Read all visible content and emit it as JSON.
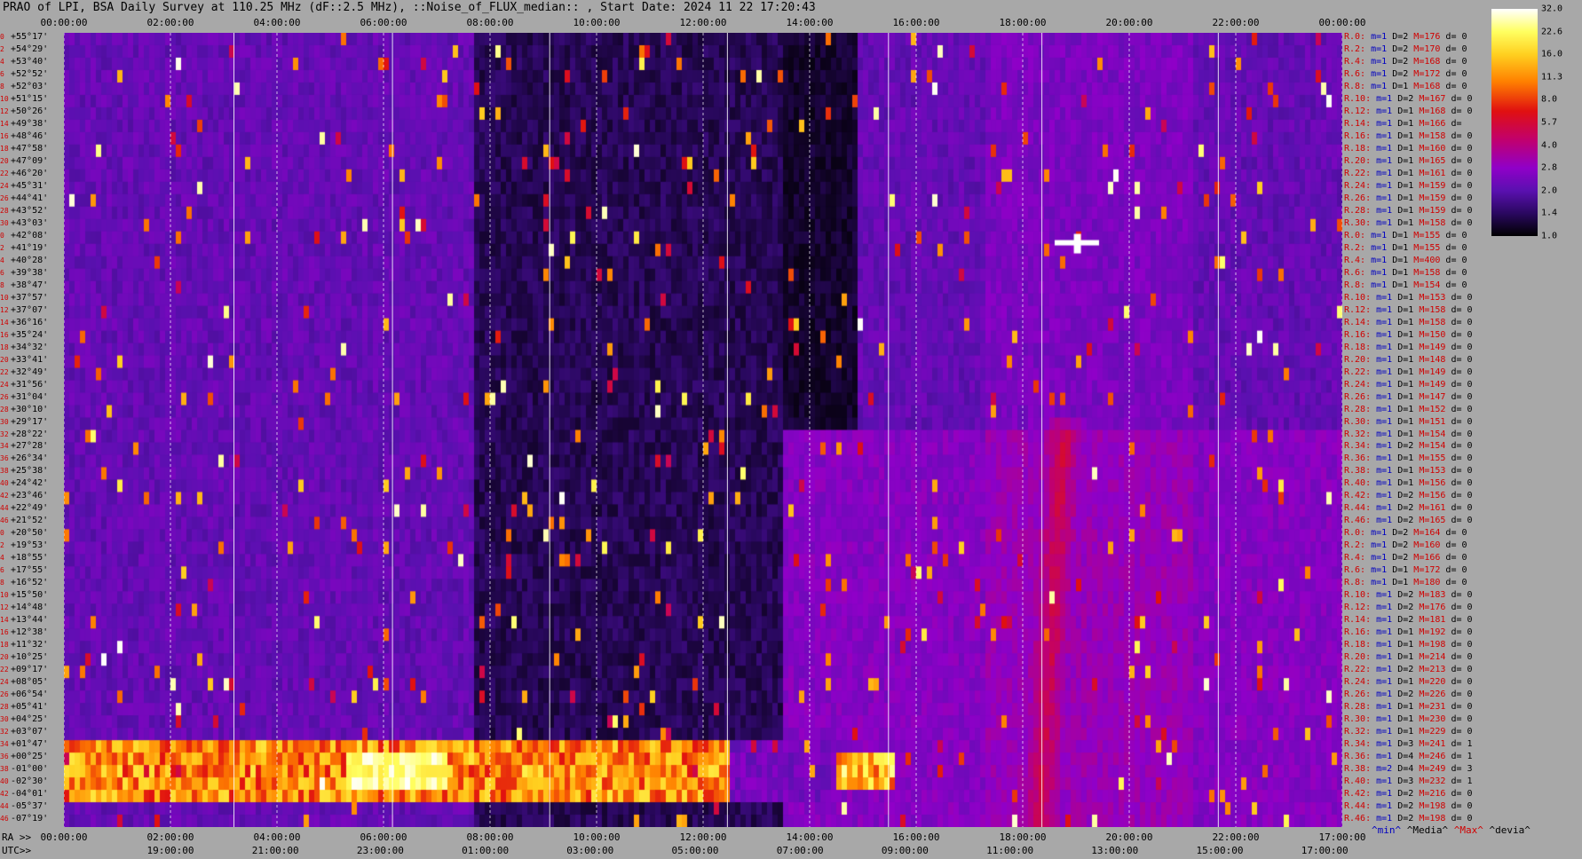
{
  "title": "PRAO of LPI, BSA Daily Survey at 110.25 MHz (dF::2.5 MHz), ::Noise_of_FLUX_median:: , Start Date: 2024 11 22 17:20:43",
  "axis": {
    "ra_prefix": "RA >>",
    "utc_prefix": "UTC>>",
    "top_ticks": [
      "00:00:00",
      "02:00:00",
      "04:00:00",
      "06:00:00",
      "08:00:00",
      "10:00:00",
      "12:00:00",
      "14:00:00",
      "16:00:00",
      "18:00:00",
      "20:00:00",
      "22:00:00",
      "00:00:00"
    ],
    "ra_ticks": [
      "00:00:00",
      "02:00:00",
      "04:00:00",
      "06:00:00",
      "08:00:00",
      "10:00:00",
      "12:00:00",
      "14:00:00",
      "16:00:00",
      "18:00:00",
      "20:00:00",
      "22:00:00",
      "17:00:00"
    ],
    "utc_ticks": [
      "19:00:00",
      "21:00:00",
      "23:00:00",
      "01:00:00",
      "03:00:00",
      "05:00:00",
      "07:00:00",
      "09:00:00",
      "11:00:00",
      "13:00:00",
      "15:00:00",
      "17:00:00"
    ]
  },
  "colors": {
    "stat_beam": "#d00000",
    "stat_min": "#0000c0",
    "stat_max": "#d00000",
    "dec_index": "#d00000",
    "background": "#a8a8a8"
  },
  "colorbar": {
    "ticks": [
      "32.0",
      "22.6",
      "16.0",
      "11.3",
      "8.0",
      "5.7",
      "4.0",
      "2.8",
      "2.0",
      "1.4",
      "1.0"
    ]
  },
  "legend": {
    "min": "^min^",
    "median": "^Media^",
    "max": "^Max^",
    "dev": "^devia^"
  },
  "chart_data": {
    "type": "heatmap",
    "x_axis_top": "RA 00:00:00 to 00:00:00",
    "value_scale": "log",
    "value_range": [
      1.0,
      32.0
    ],
    "rows": [
      {
        "idx": "0",
        "dec": "+55°17'",
        "beam": "R.0:",
        "m": "1",
        "D": "2",
        "M": "176",
        "d": "0"
      },
      {
        "idx": "2",
        "dec": "+54°29'",
        "beam": "R.2:",
        "m": "1",
        "D": "2",
        "M": "170",
        "d": "0"
      },
      {
        "idx": "4",
        "dec": "+53°40'",
        "beam": "R.4:",
        "m": "1",
        "D": "2",
        "M": "168",
        "d": "0"
      },
      {
        "idx": "6",
        "dec": "+52°52'",
        "beam": "R.6:",
        "m": "1",
        "D": "2",
        "M": "172",
        "d": "0"
      },
      {
        "idx": "8",
        "dec": "+52°03'",
        "beam": "R.8:",
        "m": "1",
        "D": "1",
        "M": "168",
        "d": "0"
      },
      {
        "idx": "10",
        "dec": "+51°15'",
        "beam": "R.10:",
        "m": "1",
        "D": "2",
        "M": "167",
        "d": "0"
      },
      {
        "idx": "12",
        "dec": "+50°26'",
        "beam": "R.12:",
        "m": "1",
        "D": "1",
        "M": "168",
        "d": "0"
      },
      {
        "idx": "14",
        "dec": "+49°38'",
        "beam": "R.14:",
        "m": "1",
        "D": "1",
        "M": "166",
        "d": ""
      },
      {
        "idx": "16",
        "dec": "+48°46'",
        "beam": "R.16:",
        "m": "1",
        "D": "1",
        "M": "158",
        "d": "0"
      },
      {
        "idx": "18",
        "dec": "+47°58'",
        "beam": "R.18:",
        "m": "1",
        "D": "1",
        "M": "160",
        "d": "0"
      },
      {
        "idx": "20",
        "dec": "+47°09'",
        "beam": "R.20:",
        "m": "1",
        "D": "1",
        "M": "165",
        "d": "0"
      },
      {
        "idx": "22",
        "dec": "+46°20'",
        "beam": "R.22:",
        "m": "1",
        "D": "1",
        "M": "161",
        "d": "0"
      },
      {
        "idx": "24",
        "dec": "+45°31'",
        "beam": "R.24:",
        "m": "1",
        "D": "1",
        "M": "159",
        "d": "0"
      },
      {
        "idx": "26",
        "dec": "+44°41'",
        "beam": "R.26:",
        "m": "1",
        "D": "1",
        "M": "159",
        "d": "0"
      },
      {
        "idx": "28",
        "dec": "+43°52'",
        "beam": "R.28:",
        "m": "1",
        "D": "1",
        "M": "159",
        "d": "0"
      },
      {
        "idx": "30",
        "dec": "+43°03'",
        "beam": "R.30:",
        "m": "1",
        "D": "1",
        "M": "158",
        "d": "0"
      },
      {
        "idx": "0",
        "dec": "+42°08'",
        "beam": "R.0:",
        "m": "1",
        "D": "1",
        "M": "155",
        "d": "0"
      },
      {
        "idx": "2",
        "dec": "+41°19'",
        "beam": "R.2:",
        "m": "1",
        "D": "1",
        "M": "155",
        "d": "0"
      },
      {
        "idx": "4",
        "dec": "+40°28'",
        "beam": "R.4:",
        "m": "1",
        "D": "1",
        "M": "400",
        "d": "0"
      },
      {
        "idx": "6",
        "dec": "+39°38'",
        "beam": "R.6:",
        "m": "1",
        "D": "1",
        "M": "158",
        "d": "0"
      },
      {
        "idx": "8",
        "dec": "+38°47'",
        "beam": "R.8:",
        "m": "1",
        "D": "1",
        "M": "154",
        "d": "0"
      },
      {
        "idx": "10",
        "dec": "+37°57'",
        "beam": "R.10:",
        "m": "1",
        "D": "1",
        "M": "153",
        "d": "0"
      },
      {
        "idx": "12",
        "dec": "+37°07'",
        "beam": "R.12:",
        "m": "1",
        "D": "1",
        "M": "158",
        "d": "0"
      },
      {
        "idx": "14",
        "dec": "+36°16'",
        "beam": "R.14:",
        "m": "1",
        "D": "1",
        "M": "158",
        "d": "0"
      },
      {
        "idx": "16",
        "dec": "+35°24'",
        "beam": "R.16:",
        "m": "1",
        "D": "1",
        "M": "150",
        "d": "0"
      },
      {
        "idx": "18",
        "dec": "+34°32'",
        "beam": "R.18:",
        "m": "1",
        "D": "1",
        "M": "149",
        "d": "0"
      },
      {
        "idx": "20",
        "dec": "+33°41'",
        "beam": "R.20:",
        "m": "1",
        "D": "1",
        "M": "148",
        "d": "0"
      },
      {
        "idx": "22",
        "dec": "+32°49'",
        "beam": "R.22:",
        "m": "1",
        "D": "1",
        "M": "149",
        "d": "0"
      },
      {
        "idx": "24",
        "dec": "+31°56'",
        "beam": "R.24:",
        "m": "1",
        "D": "1",
        "M": "149",
        "d": "0"
      },
      {
        "idx": "26",
        "dec": "+31°04'",
        "beam": "R.26:",
        "m": "1",
        "D": "1",
        "M": "147",
        "d": "0"
      },
      {
        "idx": "28",
        "dec": "+30°10'",
        "beam": "R.28:",
        "m": "1",
        "D": "1",
        "M": "152",
        "d": "0"
      },
      {
        "idx": "30",
        "dec": "+29°17'",
        "beam": "R.30:",
        "m": "1",
        "D": "1",
        "M": "151",
        "d": "0"
      },
      {
        "idx": "32",
        "dec": "+28°22'",
        "beam": "R.32:",
        "m": "1",
        "D": "1",
        "M": "154",
        "d": "0"
      },
      {
        "idx": "34",
        "dec": "+27°28'",
        "beam": "R.34:",
        "m": "1",
        "D": "2",
        "M": "154",
        "d": "0"
      },
      {
        "idx": "36",
        "dec": "+26°34'",
        "beam": "R.36:",
        "m": "1",
        "D": "1",
        "M": "155",
        "d": "0"
      },
      {
        "idx": "38",
        "dec": "+25°38'",
        "beam": "R.38:",
        "m": "1",
        "D": "1",
        "M": "153",
        "d": "0"
      },
      {
        "idx": "40",
        "dec": "+24°42'",
        "beam": "R.40:",
        "m": "1",
        "D": "1",
        "M": "156",
        "d": "0"
      },
      {
        "idx": "42",
        "dec": "+23°46'",
        "beam": "R.42:",
        "m": "1",
        "D": "2",
        "M": "156",
        "d": "0"
      },
      {
        "idx": "44",
        "dec": "+22°49'",
        "beam": "R.44:",
        "m": "1",
        "D": "2",
        "M": "161",
        "d": "0"
      },
      {
        "idx": "46",
        "dec": "+21°52'",
        "beam": "R.46:",
        "m": "1",
        "D": "2",
        "M": "165",
        "d": "0"
      },
      {
        "idx": "0",
        "dec": "+20°50'",
        "beam": "R.0:",
        "m": "1",
        "D": "2",
        "M": "164",
        "d": "0"
      },
      {
        "idx": "2",
        "dec": "+19°53'",
        "beam": "R.2:",
        "m": "1",
        "D": "2",
        "M": "160",
        "d": "0"
      },
      {
        "idx": "4",
        "dec": "+18°55'",
        "beam": "R.4:",
        "m": "1",
        "D": "2",
        "M": "166",
        "d": "0"
      },
      {
        "idx": "6",
        "dec": "+17°55'",
        "beam": "R.6:",
        "m": "1",
        "D": "1",
        "M": "172",
        "d": "0"
      },
      {
        "idx": "8",
        "dec": "+16°52'",
        "beam": "R.8:",
        "m": "1",
        "D": "1",
        "M": "180",
        "d": "0"
      },
      {
        "idx": "10",
        "dec": "+15°50'",
        "beam": "R.10:",
        "m": "1",
        "D": "2",
        "M": "183",
        "d": "0"
      },
      {
        "idx": "12",
        "dec": "+14°48'",
        "beam": "R.12:",
        "m": "1",
        "D": "2",
        "M": "176",
        "d": "0"
      },
      {
        "idx": "14",
        "dec": "+13°44'",
        "beam": "R.14:",
        "m": "1",
        "D": "2",
        "M": "181",
        "d": "0"
      },
      {
        "idx": "16",
        "dec": "+12°38'",
        "beam": "R.16:",
        "m": "1",
        "D": "1",
        "M": "192",
        "d": "0"
      },
      {
        "idx": "18",
        "dec": "+11°32'",
        "beam": "R.18:",
        "m": "1",
        "D": "1",
        "M": "198",
        "d": "0"
      },
      {
        "idx": "20",
        "dec": "+10°25'",
        "beam": "R.20:",
        "m": "1",
        "D": "1",
        "M": "214",
        "d": "0"
      },
      {
        "idx": "22",
        "dec": "+09°17'",
        "beam": "R.22:",
        "m": "1",
        "D": "2",
        "M": "213",
        "d": "0"
      },
      {
        "idx": "24",
        "dec": "+08°05'",
        "beam": "R.24:",
        "m": "1",
        "D": "1",
        "M": "220",
        "d": "0"
      },
      {
        "idx": "26",
        "dec": "+06°54'",
        "beam": "R.26:",
        "m": "1",
        "D": "2",
        "M": "226",
        "d": "0"
      },
      {
        "idx": "28",
        "dec": "+05°41'",
        "beam": "R.28:",
        "m": "1",
        "D": "1",
        "M": "231",
        "d": "0"
      },
      {
        "idx": "30",
        "dec": "+04°25'",
        "beam": "R.30:",
        "m": "1",
        "D": "1",
        "M": "230",
        "d": "0"
      },
      {
        "idx": "32",
        "dec": "+03°07'",
        "beam": "R.32:",
        "m": "1",
        "D": "1",
        "M": "229",
        "d": "0"
      },
      {
        "idx": "34",
        "dec": "+01°47'",
        "beam": "R.34:",
        "m": "1",
        "D": "3",
        "M": "241",
        "d": "1"
      },
      {
        "idx": "36",
        "dec": "+00°25'",
        "beam": "R.36:",
        "m": "1",
        "D": "4",
        "M": "246",
        "d": "1"
      },
      {
        "idx": "38",
        "dec": "-01°00'",
        "beam": "R.38:",
        "m": "2",
        "D": "4",
        "M": "249",
        "d": "3"
      },
      {
        "idx": "40",
        "dec": "-02°30'",
        "beam": "R.40:",
        "m": "1",
        "D": "3",
        "M": "232",
        "d": "1"
      },
      {
        "idx": "42",
        "dec": "-04°01'",
        "beam": "R.42:",
        "m": "1",
        "D": "2",
        "M": "216",
        "d": "0"
      },
      {
        "idx": "44",
        "dec": "-05°37'",
        "beam": "R.44:",
        "m": "1",
        "D": "2",
        "M": "198",
        "d": "0"
      },
      {
        "idx": "46",
        "dec": "-07°19'",
        "beam": "R.46:",
        "m": "1",
        "D": "2",
        "M": "198",
        "d": "0"
      }
    ]
  }
}
